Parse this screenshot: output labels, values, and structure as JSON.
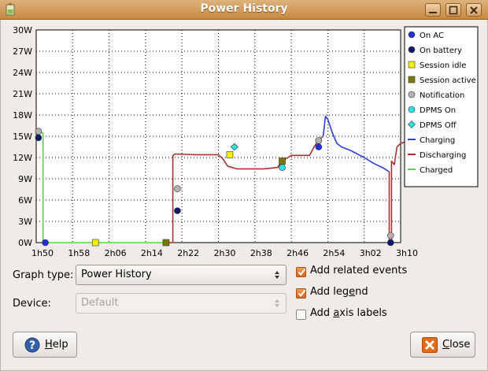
{
  "window": {
    "title": "Power History"
  },
  "chart_data": {
    "type": "line",
    "ylabel": "",
    "xlabel": "",
    "y_ticks": [
      "30W",
      "27W",
      "24W",
      "21W",
      "18W",
      "15W",
      "12W",
      "9W",
      "6W",
      "3W",
      "0W"
    ],
    "x_ticks": [
      "1h50",
      "1h58",
      "2h06",
      "2h14",
      "2h22",
      "2h30",
      "2h38",
      "2h46",
      "2h54",
      "3h02",
      "3h10"
    ],
    "x_range_minutes": [
      110,
      190
    ],
    "y_range_watts": [
      0,
      30
    ],
    "series": [
      {
        "name": "Charged",
        "color": "#4fdb3a",
        "points": [
          [
            110.5,
            15.5
          ],
          [
            111.5,
            15.5
          ],
          [
            111.5,
            0
          ],
          [
            139,
            0
          ]
        ]
      },
      {
        "name": "Discharging",
        "color": "#a83232",
        "points": [
          [
            139,
            0
          ],
          [
            140,
            0
          ],
          [
            140,
            12.3
          ],
          [
            140.5,
            12.5
          ],
          [
            145,
            12.4
          ],
          [
            150,
            12.4
          ],
          [
            151,
            11.8
          ],
          [
            152,
            10.8
          ],
          [
            154,
            10.4
          ],
          [
            160,
            10.4
          ],
          [
            163,
            10.6
          ],
          [
            164,
            11.5
          ],
          [
            166,
            12.3
          ],
          [
            170,
            12.3
          ],
          [
            171,
            13.5
          ],
          [
            172,
            14.5
          ],
          [
            173,
            15
          ]
        ]
      },
      {
        "name": "Charging",
        "color": "#2d3fdf",
        "points": [
          [
            173,
            15
          ],
          [
            173.5,
            17.8
          ],
          [
            174,
            17.4
          ],
          [
            175,
            15.5
          ],
          [
            176,
            14
          ],
          [
            177,
            13.5
          ],
          [
            179,
            13
          ],
          [
            182,
            12
          ],
          [
            184,
            11.2
          ],
          [
            186,
            10.6
          ],
          [
            187,
            10.2
          ],
          [
            187.5,
            10
          ]
        ]
      },
      {
        "name": "Discharging",
        "color": "#a83232",
        "points": [
          [
            187.5,
            10
          ],
          [
            187.5,
            0
          ],
          [
            188,
            0
          ],
          [
            188,
            11.5
          ],
          [
            188.6,
            11
          ],
          [
            189.2,
            13.5
          ],
          [
            190,
            14
          ],
          [
            191,
            14.2
          ]
        ]
      }
    ],
    "events": [
      {
        "type": "Notification",
        "x": 110.5,
        "y": 15.7
      },
      {
        "type": "On battery",
        "x": 110.5,
        "y": 14.8
      },
      {
        "type": "On AC",
        "x": 112,
        "y": 0
      },
      {
        "type": "Session idle",
        "x": 123,
        "y": 0
      },
      {
        "type": "Session active",
        "x": 138.5,
        "y": 0
      },
      {
        "type": "Notification",
        "x": 141,
        "y": 7.6
      },
      {
        "type": "On battery",
        "x": 141,
        "y": 4.5
      },
      {
        "type": "Session idle",
        "x": 152.5,
        "y": 12.4
      },
      {
        "type": "DPMS Off",
        "x": 153.5,
        "y": 13.5
      },
      {
        "type": "DPMS On",
        "x": 164,
        "y": 10.6
      },
      {
        "type": "Session active",
        "x": 164,
        "y": 11.5
      },
      {
        "type": "Notification",
        "x": 172,
        "y": 14.4
      },
      {
        "type": "On AC",
        "x": 172,
        "y": 13.5
      },
      {
        "type": "Notification",
        "x": 187.8,
        "y": 1
      },
      {
        "type": "On battery",
        "x": 187.8,
        "y": 0
      }
    ],
    "legend": [
      {
        "label": "On AC",
        "shape": "circle",
        "color": "#1e2fdc"
      },
      {
        "label": "On battery",
        "shape": "circle",
        "color": "#101a6b"
      },
      {
        "label": "Session idle",
        "shape": "square",
        "color": "#f5f000"
      },
      {
        "label": "Session active",
        "shape": "square",
        "color": "#7a7a00"
      },
      {
        "label": "Notification",
        "shape": "circle",
        "color": "#b3b3b3"
      },
      {
        "label": "DPMS On",
        "shape": "circle",
        "color": "#28e6e6"
      },
      {
        "label": "DPMS Off",
        "shape": "diamond",
        "color": "#28e6e6"
      },
      {
        "label": "Charging",
        "shape": "line",
        "color": "#2d3fdf"
      },
      {
        "label": "Discharging",
        "shape": "line",
        "color": "#a83232"
      },
      {
        "label": "Charged",
        "shape": "line",
        "color": "#4fdb3a"
      }
    ],
    "grid": true,
    "legend_position": "right"
  },
  "controls": {
    "graph_type_label": "Graph type:",
    "graph_type_value": "Power History",
    "device_label": "Device:",
    "device_value": "Default",
    "events_label": "Add related events",
    "events_checked": true,
    "legend_label": "Add legend",
    "legend_checked": true,
    "axis_label": "Add axis labels",
    "axis_checked": false
  },
  "buttons": {
    "help": "Help",
    "close": "Close"
  }
}
